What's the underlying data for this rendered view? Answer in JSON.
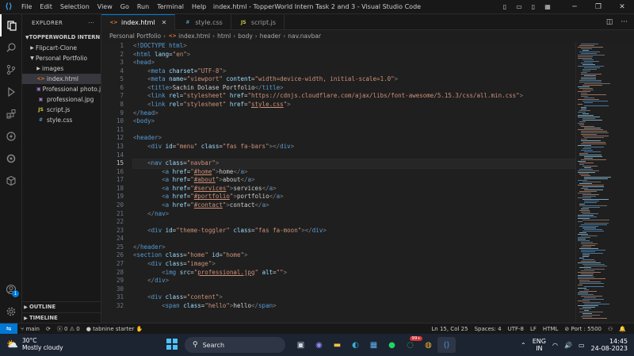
{
  "titlebar": {
    "menu": [
      "File",
      "Edit",
      "Selection",
      "View",
      "Go",
      "Run",
      "Terminal",
      "Help"
    ],
    "title": "index.html - TopperWorld Intern Task 2 and 3 - Visual Studio Code"
  },
  "sidebar": {
    "title": "EXPLORER",
    "more": "···",
    "project": "TOPPERWORLD INTERN T...",
    "items": [
      {
        "label": "Flipcart-Clone"
      },
      {
        "label": "Personal Portfolio"
      },
      {
        "label": "images"
      },
      {
        "label": "index.html"
      },
      {
        "label": "Professional photo.j..."
      },
      {
        "label": "professional.jpg"
      },
      {
        "label": "script.js"
      },
      {
        "label": "style.css"
      }
    ],
    "outline": "OUTLINE",
    "timeline": "TIMELINE"
  },
  "tabs": [
    {
      "label": "index.html"
    },
    {
      "label": "style.css"
    },
    {
      "label": "script.js"
    }
  ],
  "breadcrumb": [
    "Personal Portfolio",
    "index.html",
    "html",
    "body",
    "header",
    "nav.navbar"
  ],
  "editor": {
    "current_line": 15,
    "lines": [
      "<!DOCTYPE html>",
      "<html lang=\"en\">",
      "<head>",
      "    <meta charset=\"UTF-8\">",
      "    <meta name=\"viewport\" content=\"width=device-width, initial-scale=1.0\">",
      "    <title>Sachin Dolase Portfolio</title>",
      "    <link rel=\"stylesheet\" href=\"https://cdnjs.cloudflare.com/ajax/libs/font-awesome/5.15.3/css/all.min.css\">",
      "    <link rel=\"stylesheet\" href=\"style.css\">",
      "</head>",
      "<body>",
      "",
      "<header>",
      "    <div id=\"menu\" class=\"fas fa-bars\"></div>",
      "",
      "    <nav class=\"navbar\">",
      "        <a href=\"#home\">home</a>",
      "        <a href=\"#about\">about</a>",
      "        <a href=\"#services\">services</a>",
      "        <a href=\"#portfolio\">portfolio</a>",
      "        <a href=\"#contact\">contact</a>",
      "    </nav>",
      "",
      "    <div id=\"theme-toggler\" class=\"fas fa-moon\"></div>",
      "",
      "</header>",
      "<section class=\"home\" id=\"home\">",
      "    <div class=\"image\">",
      "        <img src=\"professional.jpg\" alt=\"\">",
      "    </div>",
      "",
      "    <div class=\"content\">",
      "        <span class=\"hello\">hello</span>"
    ]
  },
  "statusbar": {
    "branch": "main",
    "problems": "0",
    "warnings": "0",
    "tabnine": "tabnine starter",
    "position": "Ln 15, Col 25",
    "spaces": "Spaces: 4",
    "encoding": "UTF-8",
    "eol": "LF",
    "language": "HTML",
    "port": "Port : 5500"
  },
  "taskbar": {
    "temp": "30°C",
    "weather": "Mostly cloudy",
    "search": "Search",
    "badge": "99+",
    "lang1": "ENG",
    "lang2": "IN",
    "time": "14:45",
    "date": "24-08-2023"
  },
  "colors": {
    "accent": "#0078d4",
    "tag": "#569cd6",
    "attribute": "#9cdcfe",
    "string": "#ce9178"
  }
}
